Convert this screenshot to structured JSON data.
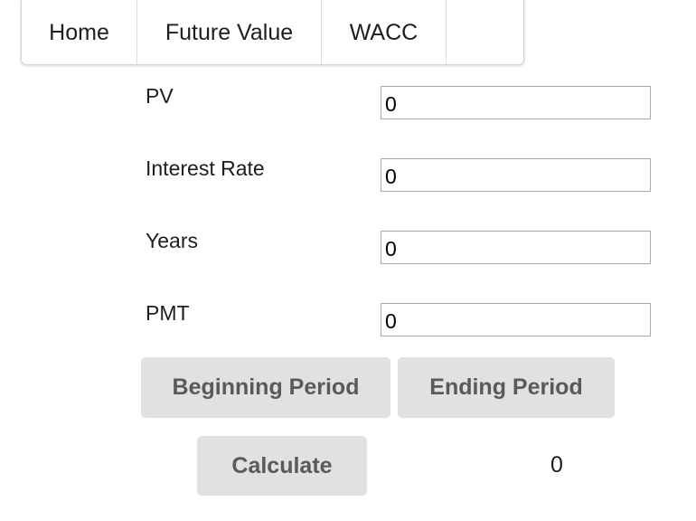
{
  "nav": {
    "items": [
      {
        "label": "Home"
      },
      {
        "label": "Future Value"
      },
      {
        "label": "WACC"
      }
    ]
  },
  "form": {
    "fields": [
      {
        "label": "PV",
        "value": "0"
      },
      {
        "label": "Interest Rate",
        "value": "0"
      },
      {
        "label": "Years",
        "value": "0"
      },
      {
        "label": "PMT",
        "value": "0"
      }
    ]
  },
  "buttons": {
    "beginning_period": "Beginning Period",
    "ending_period": "Ending Period",
    "calculate": "Calculate"
  },
  "result": {
    "value": "0"
  }
}
